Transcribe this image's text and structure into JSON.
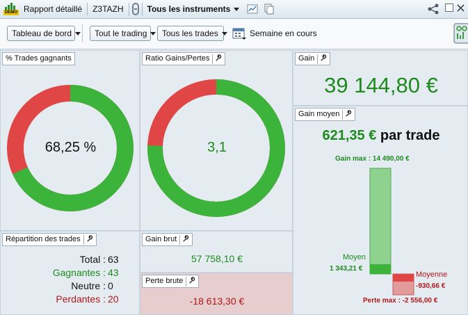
{
  "titlebar": {
    "badge": "DEMO",
    "report": "Rapport détaillé",
    "account": "Z3TAZH",
    "instruments": "Tous les instruments"
  },
  "toolbar": {
    "dashboard": "Tableau de bord",
    "trading": "Tout le trading",
    "trades": "Tous les trades",
    "period": "Semaine en cours"
  },
  "colors": {
    "win": "#3cb43c",
    "loss": "#e04646",
    "accent_green": "#1e8a1e",
    "accent_red": "#b01717"
  },
  "panels": {
    "win_pct": {
      "title": "% Trades gagnants",
      "value": "68,25 %",
      "fraction": 0.6825
    },
    "ratio": {
      "title": "Ratio Gains/Pertes",
      "value": "3,1",
      "fraction": 0.756
    },
    "gain": {
      "title": "Gain",
      "value": "39 144,80 €"
    },
    "avg_gain": {
      "title": "Gain moyen",
      "value": "621,35 €",
      "suffix": "par trade",
      "max_label": "Gain max : 14 490,00 €",
      "avg_win_label": "Moyen",
      "avg_win_value": "1 343,21 €",
      "avg_loss_label": "Moyenne",
      "avg_loss_value": "-930,66 €",
      "min_label": "Perte max : -2 556,00 €",
      "gain_max": 14490.0,
      "avg_win": 1343.21,
      "avg_loss": 930.66,
      "loss_max": 2556.0
    },
    "distribution": {
      "title": "Répartition des trades",
      "total_label": "Total :",
      "total": "63",
      "win_label": "Gagnantes :",
      "win": "43",
      "neutral_label": "Neutre :",
      "neutral": "0",
      "loss_label": "Perdantes :",
      "loss": "20"
    },
    "gross_gain": {
      "title": "Gain brut",
      "value": "57 758,10 €"
    },
    "gross_loss": {
      "title": "Perte brute",
      "value": "-18 613,30 €"
    }
  }
}
